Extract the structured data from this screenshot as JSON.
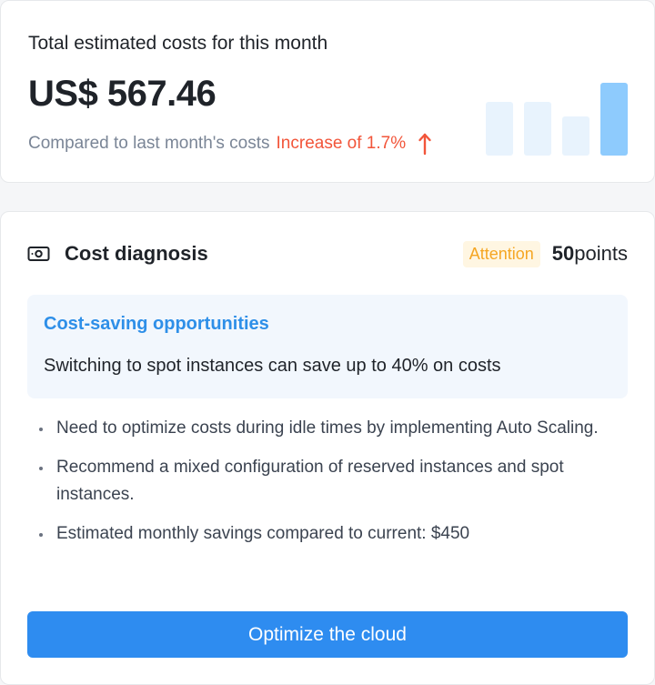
{
  "summary": {
    "label": "Total estimated costs for this month",
    "amount": "US$ 567.46",
    "compare_label": "Compared to last month's costs",
    "change_text": "Increase of 1.7%",
    "change_icon": "arrow-up-icon",
    "change_color": "#f2553a",
    "trend_values": [
      0.74,
      0.74,
      0.54,
      1.0
    ],
    "trend_colors": [
      "#e8f3fd",
      "#e8f3fd",
      "#e8f3fd",
      "#8ecbfd"
    ]
  },
  "diagnosis": {
    "icon": "cash-icon",
    "title": "Cost diagnosis",
    "status_badge": "Attention",
    "score_value": "50",
    "score_unit": "points",
    "opportunity": {
      "title": "Cost-saving opportunities",
      "text": "Switching to spot instances can save up to 40% on costs"
    },
    "tips": [
      "Need to optimize costs during idle times by implementing Auto Scaling.",
      "Recommend a mixed configuration of reserved instances and spot instances.",
      "Estimated monthly savings compared to current: $450"
    ],
    "action_label": "Optimize the cloud"
  },
  "colors": {
    "accent": "#2e8cf0",
    "warning": "#f5a623",
    "danger": "#f2553a"
  }
}
